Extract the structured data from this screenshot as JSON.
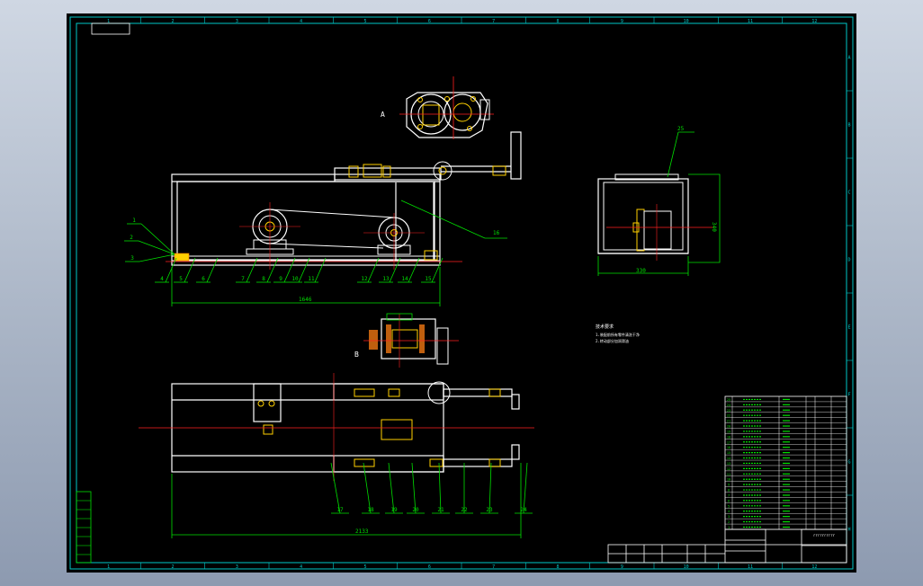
{
  "colors": {
    "background": "#000000",
    "frame": "#ffffff",
    "border": "#00c8c8",
    "dimension": "#00e000",
    "centerline": "#ff2020",
    "balloon": "#00e000",
    "hatch": "#e07010",
    "part_detail": "#ffd000",
    "leader": "#a0a0ff"
  },
  "border_columns": [
    "1",
    "2",
    "3",
    "4",
    "5",
    "6",
    "7",
    "8",
    "9",
    "10",
    "11",
    "12"
  ],
  "border_rows": [
    "A",
    "B",
    "C",
    "D",
    "E",
    "F",
    "G",
    "H"
  ],
  "views": {
    "top_detail_label": "A",
    "middle_detail_label": "B"
  },
  "front_view": {
    "balloons_left": [
      "1",
      "2",
      "3"
    ],
    "balloons_bottom": [
      "4",
      "5",
      "6",
      "7",
      "8",
      "9",
      "10",
      "11",
      "12",
      "13",
      "14",
      "15"
    ],
    "balloon_16": "16",
    "dimension_length": "1646"
  },
  "side_view": {
    "balloon": "25",
    "dimension_width": "330",
    "dimension_height": "340"
  },
  "plan_view": {
    "balloons": [
      "17",
      "18",
      "19",
      "20",
      "21",
      "22",
      "23",
      "24"
    ],
    "dimension_length": "2133"
  },
  "notes": {
    "title": "技术要求",
    "lines": [
      "1.装配前所有零件清洗干净",
      "2.转动部分加润滑油"
    ]
  },
  "parts_list": {
    "rows": [
      "25",
      "24",
      "23",
      "22",
      "21",
      "20",
      "19",
      "18",
      "17",
      "16",
      "15",
      "14",
      "13",
      "12",
      "11",
      "10",
      "9",
      "8",
      "7",
      "6",
      "5",
      "4",
      "3",
      "2",
      "1"
    ]
  },
  "title_block": {
    "drawing_number": "rrrrrrrrrr"
  }
}
